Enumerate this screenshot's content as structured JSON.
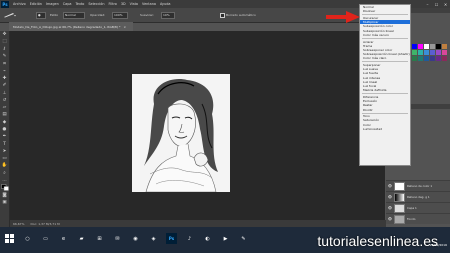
{
  "menubar": {
    "app_logo": "Ps",
    "items": [
      "Archivo",
      "Edición",
      "Imagen",
      "Capa",
      "Texto",
      "Selección",
      "Filtro",
      "3D",
      "Vista",
      "Ventana",
      "Ayuda"
    ],
    "window_controls": [
      "–",
      "☐",
      "✕"
    ]
  },
  "options_bar": {
    "style_label": "Estilo",
    "style_value": "Normal",
    "opacity_label": "Opacidad:",
    "opacity_value": "100%",
    "flow_label": "Suavizar:",
    "flow_value": "10%",
    "auto_label": "Borrado automático"
  },
  "document_tab": {
    "title": "Modelo_De_Foto_A_Dibujo.jpg al 66,7% (Relleno degradado_1, RGB/8) *",
    "close": "×"
  },
  "status_bar": {
    "zoom": "66,67%",
    "doc_info": "Doc: 1,37 M/3,71 M"
  },
  "blend_dropdown": {
    "groups": [
      [
        "Normal",
        "Disolver"
      ],
      [
        "Oscurecer",
        "Multiplicar",
        "Subexposición color",
        "Subexposición lineal",
        "Color más oscuro"
      ],
      [
        "Aclarar",
        "Trama",
        "Sobreexponer color",
        "Sobreexposición lineal (Añadir)",
        "Color más claro"
      ],
      [
        "Superponer",
        "Luz suave",
        "Luz fuerte",
        "Luz intensa",
        "Luz lineal",
        "Luz focal",
        "Mezcla definida"
      ],
      [
        "Diferencia",
        "Exclusión",
        "Restar",
        "Dividir"
      ],
      [
        "Tono",
        "Saturación",
        "Color",
        "Luminosidad"
      ]
    ],
    "selected": "Multiplicar"
  },
  "layers": [
    {
      "name": "Relleno de color 1"
    },
    {
      "name": "Relleno deg. g 1"
    },
    {
      "name": "Capa 1"
    },
    {
      "name": "Fondo"
    }
  ],
  "taskbar": {
    "start_icon": "windows-logo",
    "date_line": "28/09/2016",
    "time_line": "..."
  },
  "watermark": "tutorialesenlinea.es",
  "colors": {
    "accent_selected": "#1e6fd9",
    "arrow": "#e0241b",
    "taskbar": "#1e2a3a"
  }
}
